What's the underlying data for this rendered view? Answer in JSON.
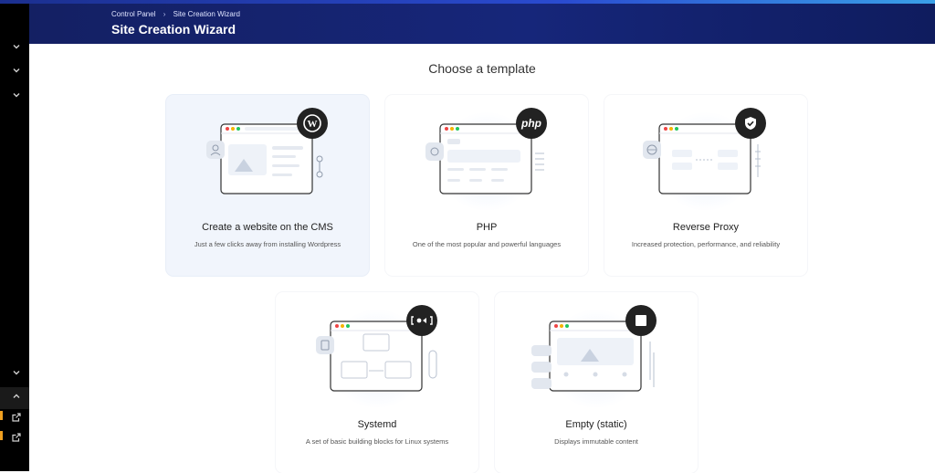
{
  "header": {
    "breadcrumb": [
      "Control Panel",
      "Site Creation Wizard"
    ],
    "title": "Site Creation Wizard"
  },
  "sidebar": {
    "icons": [
      "chevron-down-icon",
      "chevron-down-icon",
      "chevron-down-icon",
      "chevron-down-icon",
      "chevron-up-icon",
      "external-link-icon",
      "external-link-icon"
    ]
  },
  "main": {
    "section_title": "Choose a template",
    "templates": [
      {
        "title": "Create a website on the CMS",
        "description": "Just a few clicks away from installing Wordpress",
        "icon": "wordpress-icon",
        "selected": true
      },
      {
        "title": "PHP",
        "description": "One of the most popular and powerful languages",
        "icon": "php-icon",
        "badge_text": "php",
        "selected": false
      },
      {
        "title": "Reverse Proxy",
        "description": "Increased protection, performance, and reliability",
        "icon": "shield-check-icon",
        "selected": false
      },
      {
        "title": "Systemd",
        "description": "A set of basic building blocks for Linux systems",
        "icon": "systemd-icon",
        "selected": false
      },
      {
        "title": "Empty (static)",
        "description": "Displays immutable content",
        "icon": "stop-square-icon",
        "selected": false
      }
    ]
  },
  "colors": {
    "header_bg": "#16267a",
    "sidebar_bg": "#000000",
    "selected_card_bg": "#f1f5fc",
    "badge_bg": "#222222",
    "active_marker": "#f0a020"
  }
}
